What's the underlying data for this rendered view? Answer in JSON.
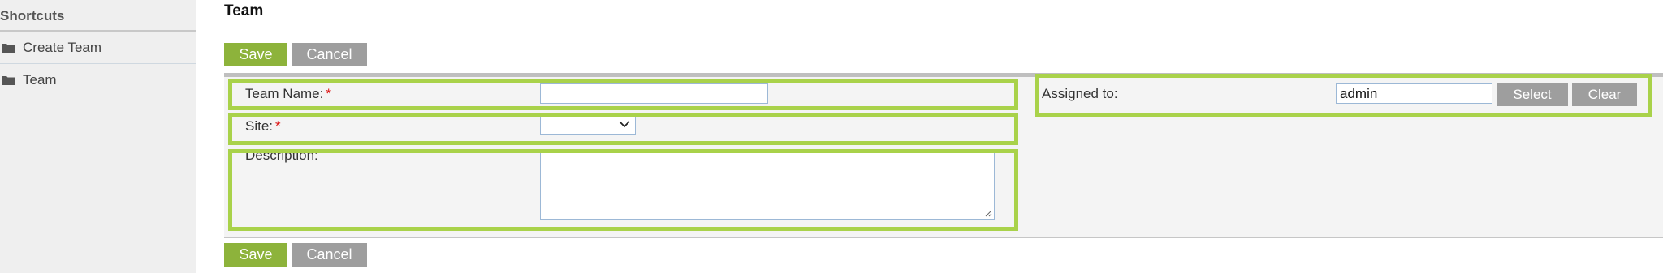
{
  "sidebar": {
    "title": "Shortcuts",
    "items": [
      {
        "label": "Create Team",
        "icon": "folder-icon"
      },
      {
        "label": "Team",
        "icon": "folder-icon"
      }
    ]
  },
  "page": {
    "title": "Team"
  },
  "toolbar": {
    "save_label": "Save",
    "cancel_label": "Cancel"
  },
  "form": {
    "team_name": {
      "label": "Team Name:",
      "required_mark": "*",
      "value": ""
    },
    "site": {
      "label": "Site:",
      "required_mark": "*",
      "selected": ""
    },
    "description": {
      "label": "Description:",
      "value": ""
    },
    "assigned_to": {
      "label": "Assigned to:",
      "value": "admin",
      "select_label": "Select",
      "clear_label": "Clear"
    }
  },
  "colors": {
    "accent_green": "#8db33b",
    "highlight_green": "#a9d24a",
    "button_grey": "#9e9e9e"
  }
}
